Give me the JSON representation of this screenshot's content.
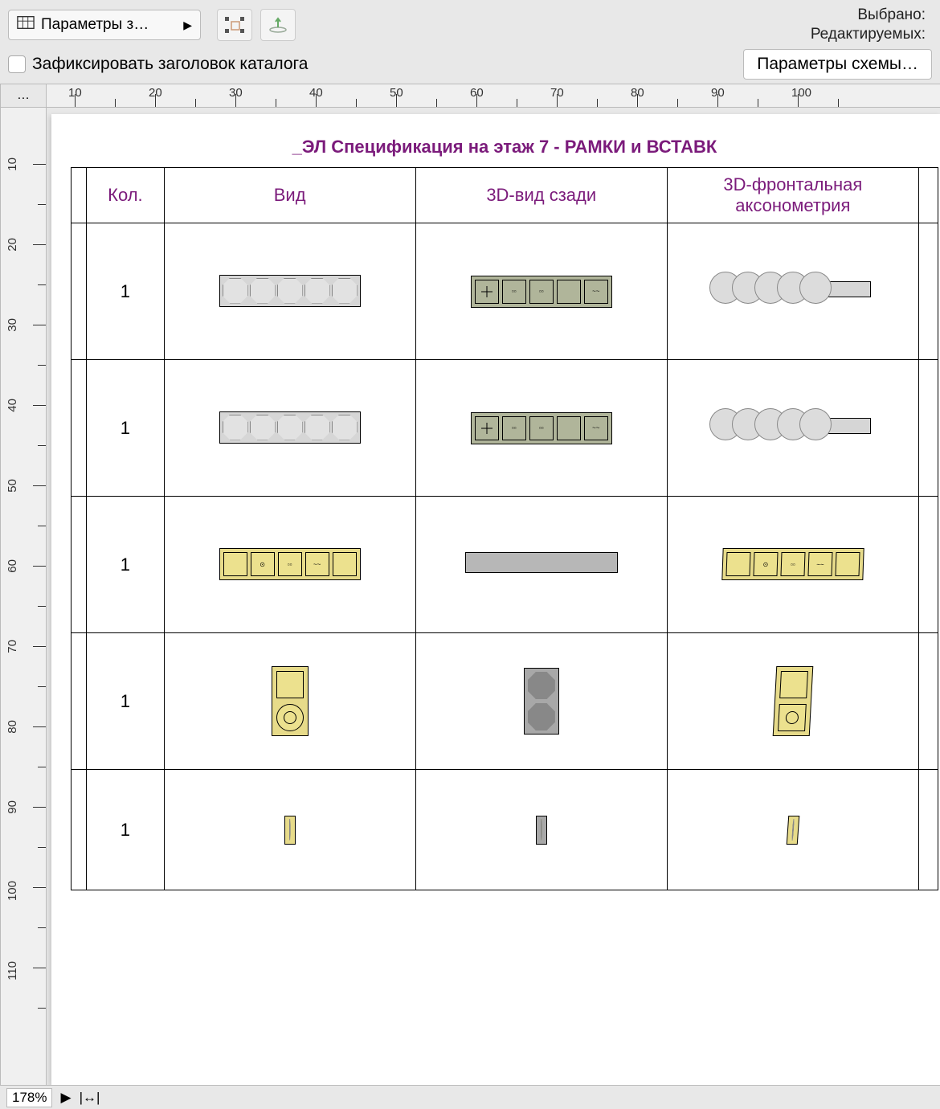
{
  "toolbar": {
    "params_label": "Параметры з…",
    "selected_label": "Выбрано:",
    "editable_label": "Редактируемых:"
  },
  "secondbar": {
    "freeze_label": "Зафиксировать заголовок каталога",
    "scheme_btn": "Параметры схемы…"
  },
  "ruler_corner": "…",
  "ruler_h": [
    10,
    20,
    30,
    40,
    50,
    60,
    70,
    80,
    90,
    100
  ],
  "ruler_v": [
    10,
    20,
    30,
    40,
    50,
    60,
    70,
    80,
    90,
    100,
    110
  ],
  "spec": {
    "title": "_ЭЛ Спецификация на этаж 7 - РАМКИ и ВСТАВК",
    "headers": [
      "Кол.",
      "Вид",
      "3D-вид сзади",
      "3D-фронтальная аксонометрия"
    ],
    "rows": [
      {
        "kol": "1"
      },
      {
        "kol": "1"
      },
      {
        "kol": "1"
      },
      {
        "kol": "1"
      },
      {
        "kol": "1"
      }
    ]
  },
  "status": {
    "zoom": "178%"
  }
}
